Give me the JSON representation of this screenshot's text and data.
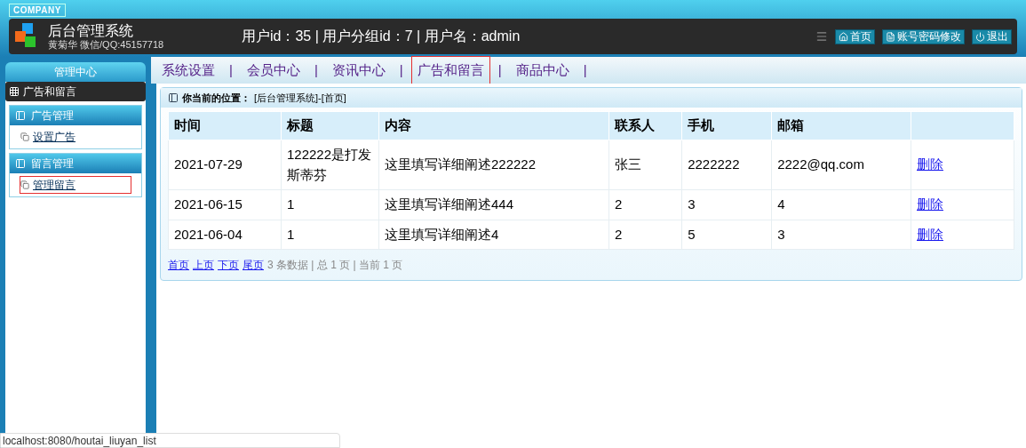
{
  "header": {
    "badge": "COMPANY",
    "title": "后台管理系统",
    "subtitle": "黄菊华 微信/QQ:45157718",
    "user_info": "用户id：35 | 用户分组id：7 | 用户名：admin",
    "buttons": [
      {
        "kind": "home",
        "label": "首页"
      },
      {
        "kind": "doc",
        "label": "账号密码修改"
      },
      {
        "kind": "power",
        "label": "退出"
      }
    ]
  },
  "nav": {
    "tabs": [
      {
        "label": "系统设置",
        "selected": false,
        "separator": "|"
      },
      {
        "label": "会员中心",
        "selected": false,
        "separator": "|"
      },
      {
        "label": "资讯中心",
        "selected": false,
        "separator": "|"
      },
      {
        "label": "广告和留言",
        "selected": true,
        "separator": "|"
      },
      {
        "label": "商品中心",
        "selected": false,
        "separator": "|"
      }
    ]
  },
  "sidebar": {
    "title": "管理中心",
    "section": "广告和留言",
    "groups": [
      {
        "title": "广告管理",
        "items": [
          {
            "label": "设置广告",
            "selected": false
          }
        ]
      },
      {
        "title": "留言管理",
        "items": [
          {
            "label": "管理留言",
            "selected": true
          }
        ]
      }
    ]
  },
  "breadcrumb": {
    "label": "你当前的位置：",
    "path": "[后台管理系统]-[首页]"
  },
  "table": {
    "columns": [
      "时间",
      "标题",
      "内容",
      "联系人",
      "手机",
      "邮箱"
    ],
    "rows": [
      {
        "cells": [
          "2021-07-29",
          "122222是打发斯蒂芬",
          "这里填写详细阐述222222",
          "张三",
          "2222222",
          "2222@qq.com"
        ],
        "action": "删除"
      },
      {
        "cells": [
          "2021-06-15",
          "1",
          "这里填写详细阐述444",
          "2",
          "3",
          "4"
        ],
        "action": "删除"
      },
      {
        "cells": [
          "2021-06-04",
          "1",
          "这里填写详细阐述4",
          "2",
          "5",
          "3"
        ],
        "action": "删除"
      }
    ]
  },
  "pagination": {
    "links": [
      "首页",
      "上页",
      "下页",
      "尾页"
    ],
    "info": "3 条数据 | 总 1 页 | 当前 1 页"
  },
  "status_bar": "localhost:8080/houtai_liuyan_list"
}
